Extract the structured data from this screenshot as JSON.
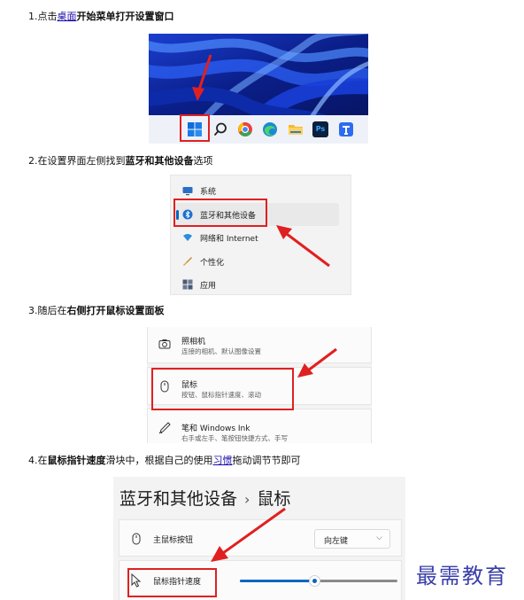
{
  "steps": {
    "s1": {
      "prefix": "1.点击",
      "link": "桌面",
      "bold": "开始菜单打开设置窗口",
      "suffix": ""
    },
    "s2": {
      "prefix": "2.在设置界面左侧找到",
      "bold": "蓝牙和其他设备",
      "suffix": "选项"
    },
    "s3": {
      "prefix": "3.随后在",
      "bold": "右侧打开鼠标设置面板",
      "suffix": ""
    },
    "s4": {
      "prefix": "4.在",
      "bold": "鼠标指针速度",
      "mid": "滑块中，根据自己的使用",
      "link": "习惯",
      "suffix": "拖动调节节即可"
    }
  },
  "taskbar": {
    "icons": [
      "windows-start-icon",
      "search-icon",
      "chrome-icon",
      "edge-icon",
      "file-explorer-icon",
      "photoshop-icon",
      "app-icon"
    ],
    "ps_label": "Ps",
    "accent": "#e02020"
  },
  "settings_nav": {
    "items": [
      {
        "label": "系统",
        "icon": "display-icon"
      },
      {
        "label": "蓝牙和其他设备",
        "icon": "bluetooth-icon",
        "active": true
      },
      {
        "label": "网络和 Internet",
        "icon": "wifi-icon"
      },
      {
        "label": "个性化",
        "icon": "brush-icon"
      },
      {
        "label": "应用",
        "icon": "apps-icon"
      }
    ]
  },
  "device_panel": {
    "items": [
      {
        "title": "照相机",
        "subtitle": "连接的相机、默认图像设置",
        "icon": "camera-icon"
      },
      {
        "title": "鼠标",
        "subtitle": "按钮、鼠标指针速度、滚动",
        "icon": "mouse-icon"
      },
      {
        "title": "笔和 Windows Ink",
        "subtitle": "右手或左手、笔按钮快捷方式、手写",
        "icon": "pen-icon"
      }
    ]
  },
  "mouse_page": {
    "crumb_parent": "蓝牙和其他设备",
    "crumb_sep": "›",
    "crumb_current": "鼠标",
    "primary_button": {
      "label": "主鼠标按钮",
      "value": "向左键",
      "arrow": "⌵"
    },
    "pointer_speed": {
      "label": "鼠标指针速度",
      "level": 0.47
    }
  },
  "watermark": "最需教育"
}
